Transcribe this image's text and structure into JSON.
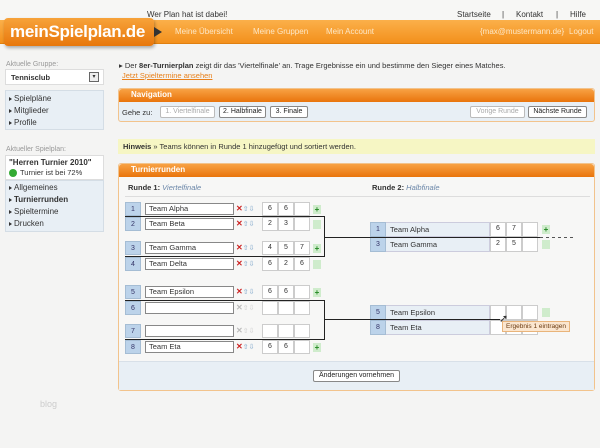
{
  "header": {
    "logo": "meinSpielplan.de",
    "tagline": "Wer Plan hat ist dabei!",
    "top_links": [
      "Startseite",
      "|",
      "Kontakt",
      "|",
      "Hilfe"
    ],
    "nav": [
      "Meine Übersicht",
      "Meine Gruppen",
      "Mein Account"
    ],
    "user_email": "{max@mustermann.de}",
    "logout": "Logout"
  },
  "sidebar": {
    "group_label": "Aktuelle Gruppe:",
    "group_value": "Tennisclub",
    "group_items": [
      "Spielpläne",
      "Mitglieder",
      "Profile"
    ],
    "plan_label": "Aktueller Spielplan:",
    "plan_title": "\"Herren Turnier 2010\"",
    "plan_progress_text": "Turnier ist bei 72%",
    "plan_progress": 72,
    "plan_items": [
      "Allgemeines",
      "Turnierrunden",
      "Spieltermine",
      "Drucken"
    ],
    "footer": "blog"
  },
  "intro": {
    "pre": "Der ",
    "bold": "8er-Turnierplan",
    "post": " zeigt dir das 'Viertelfinale' an. Trage Ergebnisse ein und bestimme den Sieger eines Matches.",
    "link": "Jetzt Spieltermine ansehen"
  },
  "navigation": {
    "title": "Navigation",
    "goto": "Gehe zu:",
    "rounds": [
      "1. Viertelfinale",
      "2. Halbfinale",
      "3. Finale"
    ],
    "prev": "Vorige Runde",
    "next": "Nächste Runde"
  },
  "hint": {
    "bold": "Hinweis",
    "text": " » Teams können in Runde 1 hinzugefügt und sortiert werden."
  },
  "rounds": {
    "title": "Turnierrunden",
    "r1_label": "Runde 1: ",
    "r1_name": "Viertelfinale",
    "r2_label": "Runde 2: ",
    "r2_name": "Halbfinale",
    "r1_teams": [
      {
        "seed": "1",
        "name": "Team Alpha",
        "scores": [
          "6",
          "6",
          ""
        ],
        "winner": true
      },
      {
        "seed": "2",
        "name": "Team Beta",
        "scores": [
          "2",
          "3",
          ""
        ],
        "winner": false
      },
      {
        "seed": "3",
        "name": "Team Gamma",
        "scores": [
          "4",
          "5",
          "7"
        ],
        "winner": true
      },
      {
        "seed": "4",
        "name": "Team Delta",
        "scores": [
          "6",
          "2",
          "6"
        ],
        "winner": false
      },
      {
        "seed": "5",
        "name": "Team Epsilon",
        "scores": [
          "6",
          "6",
          ""
        ],
        "winner": true
      },
      {
        "seed": "6",
        "name": "",
        "scores": [
          "",
          "",
          ""
        ],
        "winner": false
      },
      {
        "seed": "7",
        "name": "",
        "scores": [
          "",
          "",
          ""
        ],
        "winner": false
      },
      {
        "seed": "8",
        "name": "Team Eta",
        "scores": [
          "6",
          "6",
          ""
        ],
        "winner": true
      }
    ],
    "r2_teams": [
      {
        "seed": "1",
        "name": "Team Alpha",
        "scores": [
          "6",
          "7",
          ""
        ],
        "winner": true
      },
      {
        "seed": "3",
        "name": "Team Gamma",
        "scores": [
          "2",
          "5",
          ""
        ],
        "winner": false
      },
      {
        "seed": "5",
        "name": "Team Epsilon",
        "scores": [
          "",
          "",
          ""
        ],
        "winner": false
      },
      {
        "seed": "8",
        "name": "Team Eta",
        "scores": [
          "",
          "",
          ""
        ],
        "winner": false
      }
    ],
    "tooltip": "Ergebnis 1 eintragen",
    "submit": "Änderungen vornehmen"
  }
}
